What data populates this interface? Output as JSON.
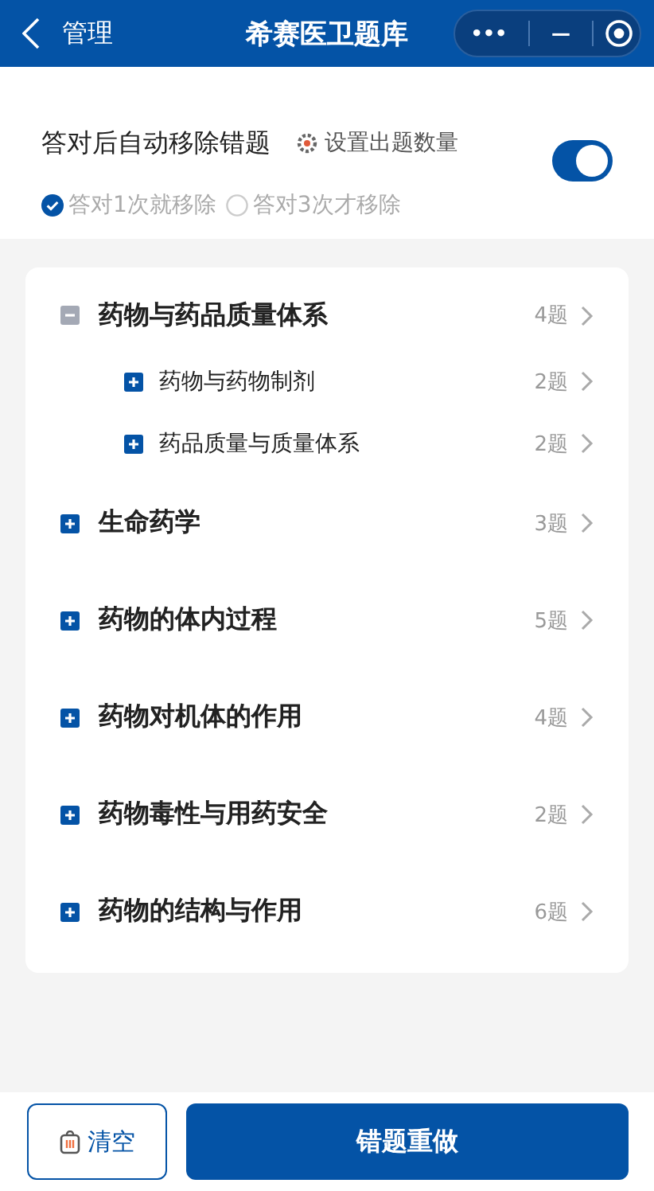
{
  "nav_bar": {
    "back_label": "管理",
    "title": "希赛医卫题库",
    "capsule": {
      "more": "•••",
      "minimize": "—"
    }
  },
  "settings": {
    "auto_remove_label": "答对后自动移除错题",
    "set_count_link": "设置出题数量",
    "auto_remove_on": true,
    "remove_options": [
      {
        "label": "答对1次就移除",
        "selected": true
      },
      {
        "label": "答对3次才移除",
        "selected": false
      }
    ]
  },
  "chapters": [
    {
      "title": "药物与药品质量体系",
      "count": "4题",
      "expanded": true,
      "children": [
        {
          "title": "药物与药物制剂",
          "count": "2题",
          "expanded": false
        },
        {
          "title": "药品质量与质量体系",
          "count": "2题",
          "expanded": false
        }
      ]
    },
    {
      "title": "生命药学",
      "count": "3题",
      "expanded": false
    },
    {
      "title": "药物的体内过程",
      "count": "5题",
      "expanded": false
    },
    {
      "title": "药物对机体的作用",
      "count": "4题",
      "expanded": false
    },
    {
      "title": "药物毒性与用药安全",
      "count": "2题",
      "expanded": false
    },
    {
      "title": "药物的结构与作用",
      "count": "6题",
      "expanded": false
    }
  ],
  "footer": {
    "clear_button": "清空",
    "redo_button": "错题重做"
  }
}
